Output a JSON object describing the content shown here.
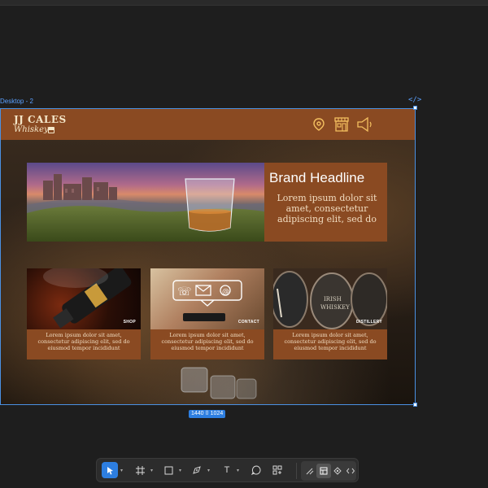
{
  "editor": {
    "frame_label": "Desktop - 2",
    "code_icon": "</>",
    "dimensions": "1440 ⌷ 1024"
  },
  "header": {
    "logo_title": "JJ CALES",
    "logo_script": "Whiskey",
    "icons": [
      "map-pin-icon",
      "storefront-icon",
      "speaker-icon"
    ]
  },
  "brand": {
    "headline": "Brand Headline",
    "body": "Lorem ipsum dolor sit amet, consectetur adipiscing elit, sed do"
  },
  "cards": [
    {
      "label": "SHOP",
      "text": "Lorem ipsum dolor sit amet, consectetur adipiscing elit, sed do eiusmod tempor incididunt"
    },
    {
      "label": "CONTACT",
      "text": "Lorem ipsum dolor sit amet, consectetur adipiscing elit, sed do eiusmod tempor incididunt"
    },
    {
      "label": "DISTILLERY",
      "text": "Lorem ipsum dolor sit amet, consectetur adipiscing elit, sed do eiusmod tempor incididunt"
    }
  ],
  "toolbar": {
    "tools": [
      "move-tool-icon",
      "frame-tool-icon",
      "shape-tool-icon",
      "pen-tool-icon",
      "text-tool-icon",
      "comment-tool-icon",
      "actions-tool-icon"
    ],
    "modes": [
      "draw-mode-icon",
      "design-mode-icon",
      "prototype-mode-icon",
      "dev-mode-icon"
    ],
    "text_tool_glyph": "T"
  },
  "colors": {
    "brand_brown": "#8a4a22",
    "accent_blue": "#2d7ee0",
    "cream": "#f4e6c8"
  }
}
